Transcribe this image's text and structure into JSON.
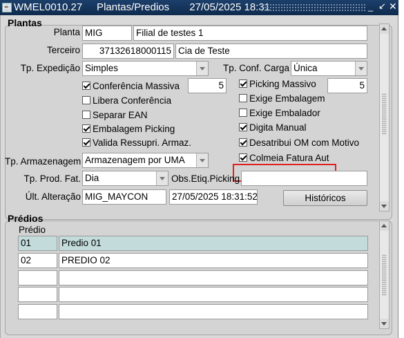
{
  "window": {
    "title": "WMEL0010.27     Plantas/Predios       27/05/2025 18:31",
    "app_icon": "oracle-forms-icon",
    "minimize": "_",
    "maximize": "↙",
    "close": "✕"
  },
  "plantas": {
    "section_title": "Plantas",
    "planta": {
      "label": "Planta",
      "code": "MIG",
      "name": "Filial de testes 1"
    },
    "terceiro": {
      "label": "Terceiro",
      "code": "37132618000115",
      "name": "Cia de Teste"
    },
    "tp_expedicao": {
      "label": "Tp. Expedição",
      "value": "Simples"
    },
    "tp_conf_carga": {
      "label": "Tp. Conf. Carga",
      "value": "Única"
    },
    "left_checks": [
      {
        "label": "Conferência Massiva",
        "checked": true
      },
      {
        "label": "Libera Conferência",
        "checked": false
      },
      {
        "label": "Separar EAN",
        "checked": false
      },
      {
        "label": "Embalagem Picking",
        "checked": true
      },
      {
        "label": "Valida Ressupri. Armaz.",
        "checked": true
      }
    ],
    "conferencia_massiva_qty": "5",
    "right_checks": [
      {
        "label": "Picking Massivo",
        "checked": true
      },
      {
        "label": "Exige Embalagem",
        "checked": false
      },
      {
        "label": "Exige Embalador",
        "checked": false
      },
      {
        "label": "Digita Manual",
        "checked": true
      },
      {
        "label": "Desatribui OM com Motivo",
        "checked": true
      },
      {
        "label": "Colmeia Fatura Aut",
        "checked": true
      }
    ],
    "picking_massivo_qty": "5",
    "tp_armazenagem": {
      "label": "Tp. Armazenagem",
      "value": "Armazenagem por UMA"
    },
    "tp_prod_fat": {
      "label": "Tp. Prod. Fat.",
      "value": "Dia"
    },
    "obs_etiq_picking": {
      "label": "Obs.Etiq.Picking",
      "value": ""
    },
    "ult_alteracao": {
      "label": "Últ. Alteração",
      "user": "MIG_MAYCON",
      "datetime": "27/05/2025 18:31:52"
    },
    "historicos_button": "Históricos"
  },
  "predios": {
    "section_title": "Prédios",
    "column_header": "Prédio",
    "rows": [
      {
        "code": "01",
        "name": "Predio 01",
        "selected": true
      },
      {
        "code": "02",
        "name": "PREDIO 02",
        "selected": false
      },
      {
        "code": "",
        "name": "",
        "selected": false
      },
      {
        "code": "",
        "name": "",
        "selected": false
      },
      {
        "code": "",
        "name": "",
        "selected": false
      }
    ]
  },
  "colors": {
    "titlebar": "#0f2b4e",
    "highlight_border": "#e02020",
    "selected_row": "#c3dbdb",
    "panel": "#d4d4d4"
  }
}
